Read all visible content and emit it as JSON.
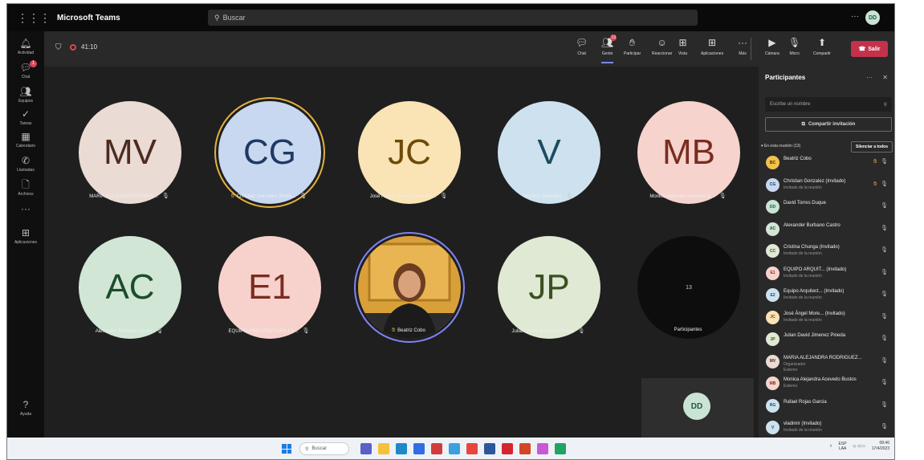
{
  "app": {
    "title": "Microsoft Teams",
    "search_placeholder": "Buscar",
    "more": "···",
    "me_initials": "DD"
  },
  "rail": [
    {
      "label": "Actividad",
      "icon": "bell-icon"
    },
    {
      "label": "Chat",
      "icon": "chat-icon",
      "badge": "1"
    },
    {
      "label": "Equipos",
      "icon": "teams-icon"
    },
    {
      "label": "Tareas",
      "icon": "tasks-icon"
    },
    {
      "label": "Calendario",
      "icon": "calendar-icon"
    },
    {
      "label": "Llamadas",
      "icon": "phone-icon"
    },
    {
      "label": "Archivos",
      "icon": "files-icon"
    },
    {
      "label": "···",
      "icon": "more-icon"
    },
    {
      "label": "Aplicaciones",
      "icon": "apps-icon"
    },
    {
      "label": "Ayuda",
      "icon": "help-icon"
    }
  ],
  "meeting": {
    "timer": "41:10",
    "toolbar": [
      {
        "label": "Chat",
        "icon": "chat-icon"
      },
      {
        "label": "Gente",
        "icon": "people-icon",
        "badge": "13",
        "active": true
      },
      {
        "label": "Participar",
        "icon": "raise-hand-icon"
      },
      {
        "label": "Reaccionar",
        "icon": "reaction-icon"
      },
      {
        "label": "Vista",
        "icon": "view-icon"
      },
      {
        "label": "Aplicaciones",
        "icon": "apps-icon"
      },
      {
        "label": "Más",
        "icon": "more-icon"
      }
    ],
    "controls": [
      {
        "label": "Cámara",
        "icon": "camera-off-icon"
      },
      {
        "label": "Micro",
        "icon": "mic-off-icon"
      },
      {
        "label": "Compartir",
        "icon": "share-icon"
      }
    ],
    "leave_label": "Salir"
  },
  "tiles": [
    {
      "initials": "MV",
      "name": "MARIA ALEJANDRA RODRIG...",
      "bg": "#eadbd4",
      "fg": "#4e2b1f"
    },
    {
      "initials": "CG",
      "name": "Christian Gonzalez (Invita...",
      "bg": "#c8d8f0",
      "fg": "#1e3a63",
      "hand": true,
      "speaking": true
    },
    {
      "initials": "JC",
      "name": "José Ángel Moreno Calderón...",
      "bg": "#fae3b4",
      "fg": "#6d4a08"
    },
    {
      "initials": "V",
      "name": "vladimir (Invitado)",
      "bg": "#cde2ee",
      "fg": "#1d4a60"
    },
    {
      "initials": "MB",
      "name": "Monica Alejandra Acevedo B...",
      "bg": "#f6d3cd",
      "fg": "#7a2c20"
    },
    {
      "initials": "AC",
      "name": "Alexander Burbano Castro",
      "bg": "#d1e6d5",
      "fg": "#1c4d2b"
    },
    {
      "initials": "E1",
      "name": "EQUIPO ARQUITECTURA 1 (I...",
      "bg": "#f7d2cc",
      "fg": "#7a2c20"
    },
    {
      "initials": "",
      "name": "Beatriz Cobo",
      "photo": true,
      "hand": true
    },
    {
      "initials": "JP",
      "name": "Julian David Jimenez Pineda",
      "bg": "#dfe9d3",
      "fg": "#3c5122"
    },
    {
      "initials": "13",
      "name": "Participantes",
      "overflow": true
    }
  ],
  "self_preview": {
    "initials": "DD"
  },
  "panel": {
    "title": "Participantes",
    "more": "···",
    "close": "✕",
    "search_placeholder": "Escribe un nombre",
    "share_label": "Compartir invitación",
    "section_label": "En esta reunión (13)",
    "mute_all": "Silenciar a todos",
    "people": [
      {
        "initials": "BC",
        "name": "Beatriz Cobo",
        "sub": "",
        "bg": "#f0c14b",
        "fg": "#3d2b00",
        "hand": true,
        "mic_on": true
      },
      {
        "initials": "CG",
        "name": "Christian Gonzalez (Invitado)",
        "sub": "Invitado de la reunión",
        "bg": "#c8d8f0",
        "fg": "#1e3a63",
        "hand": true
      },
      {
        "initials": "DD",
        "name": "David Torres Duque",
        "sub": "",
        "bg": "#c9e3d4",
        "fg": "#1d5b3b"
      },
      {
        "initials": "AC",
        "name": "Alexander Burbano Castro",
        "sub": "",
        "bg": "#d1e6d5",
        "fg": "#1c4d2b"
      },
      {
        "initials": "CC",
        "name": "Cristina Chunga (Invitado)",
        "sub": "Invitado de la reunión",
        "bg": "#dfe9d3",
        "fg": "#3c5122"
      },
      {
        "initials": "E1",
        "name": "EQUIPO ARQUIT... (Invitado)",
        "sub": "Invitado de la reunión",
        "bg": "#f7d2cc",
        "fg": "#7a2c20"
      },
      {
        "initials": "E2",
        "name": "Equipo Arquitect... (Invitado)",
        "sub": "Invitado de la reunión",
        "bg": "#cde2ee",
        "fg": "#1d4a60"
      },
      {
        "initials": "JC",
        "name": "José Ángel More... (Invitado)",
        "sub": "Invitado de la reunión",
        "bg": "#fae3b4",
        "fg": "#6d4a08"
      },
      {
        "initials": "JP",
        "name": "Julian David Jimenez Pineda",
        "sub": "",
        "bg": "#dfe9d3",
        "fg": "#3c5122"
      },
      {
        "initials": "MV",
        "name": "MARIA ALEJANDRA RODRIGUEZ...",
        "sub": "Organizador",
        "sub2": "Externo",
        "bg": "#eadbd4",
        "fg": "#4e2b1f"
      },
      {
        "initials": "MB",
        "name": "Monica Alejandra Acevedo Bustos",
        "sub": "Externo",
        "bg": "#f6d3cd",
        "fg": "#7a2c20"
      },
      {
        "initials": "RG",
        "name": "Rafael Rojas Garcia",
        "sub": "",
        "bg": "#cde2ee",
        "fg": "#1d4a60"
      },
      {
        "initials": "V",
        "name": "vladimir (Invitado)",
        "sub": "Invitado de la reunión",
        "bg": "#cde2ee",
        "fg": "#1d4a60"
      }
    ]
  },
  "taskbar": {
    "search_placeholder": "Buscar",
    "lang": "ESP",
    "lang2": "LAA",
    "time": "08:46",
    "date": "17/4/2023",
    "apps": [
      {
        "name": "teams",
        "color": "#5b5fc7"
      },
      {
        "name": "file-explorer",
        "color": "#f5c13a"
      },
      {
        "name": "edge",
        "color": "#1e88c9"
      },
      {
        "name": "store",
        "color": "#2f6fe4"
      },
      {
        "name": "mail",
        "color": "#d23b3b"
      },
      {
        "name": "photos",
        "color": "#3aa0e0"
      },
      {
        "name": "chrome",
        "color": "#e8453c"
      },
      {
        "name": "word",
        "color": "#2b579a"
      },
      {
        "name": "acrobat",
        "color": "#d3262f"
      },
      {
        "name": "powerpoint",
        "color": "#d24726"
      },
      {
        "name": "gallery",
        "color": "#c858d6"
      },
      {
        "name": "excel",
        "color": "#21a366"
      }
    ]
  }
}
